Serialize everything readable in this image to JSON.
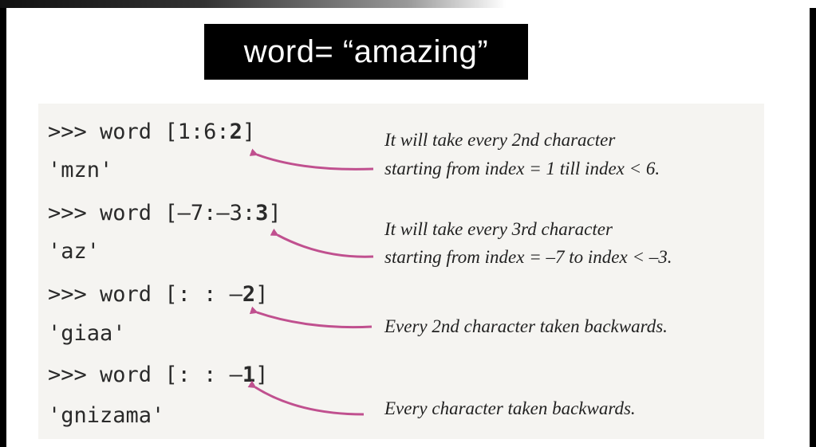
{
  "title": "word= “amazing”",
  "examples": [
    {
      "prompt": ">>> word ",
      "slice_prefix": "[1:6:",
      "slice_step": "2",
      "slice_suffix": "]",
      "result": "'mzn'",
      "note_line1": "It will take every 2nd character",
      "note_line2": "starting from index = 1 till index < 6."
    },
    {
      "prompt": ">>> word ",
      "slice_prefix": "[–7:–3:",
      "slice_step": "3",
      "slice_suffix": "]",
      "result": "'az'",
      "note_line1": "It will take every 3rd character",
      "note_line2": "starting from index = –7 to index < –3."
    },
    {
      "prompt": ">>> word ",
      "slice_prefix": "[: : –",
      "slice_step": "2",
      "slice_suffix": "]",
      "result": "'giaa'",
      "note_line1": "Every 2nd character taken backwards.",
      "note_line2": ""
    },
    {
      "prompt": ">>> word ",
      "slice_prefix": "[: : –",
      "slice_step": "1",
      "slice_suffix": "]",
      "result": "'gnizama'",
      "note_line1": "Every character taken backwards.",
      "note_line2": ""
    }
  ],
  "colors": {
    "arrow": "#c0508f",
    "title_bg": "#000000",
    "title_fg": "#ffffff"
  }
}
